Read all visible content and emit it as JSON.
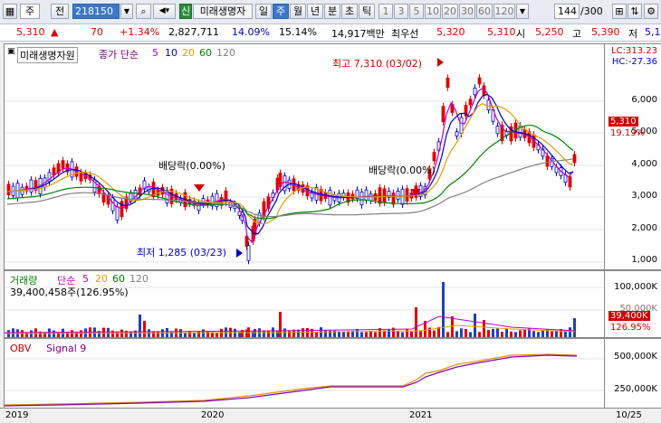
{
  "toolbar": {
    "market_select": "주",
    "view_btn": "전",
    "code": "218150",
    "status_badge": "신",
    "stock_name": "미래생명자",
    "periods": [
      "일",
      "주",
      "월",
      "년",
      "분",
      "초",
      "틱"
    ],
    "active_period": "주",
    "minute_options": [
      "1",
      "3",
      "5",
      "10",
      "20",
      "30",
      "60",
      "120"
    ],
    "count_value": "144",
    "count_total": "/300"
  },
  "quote": {
    "price": "5,310",
    "direction": "▲",
    "change": "70",
    "change_pct": "+1.34%",
    "volume": "2,827,711",
    "turnover_pct": "14.09%",
    "ratio_pct": "15.14%",
    "trade_value": "14,917백만",
    "priority_label": "최우선",
    "ask": "5,320",
    "bid": "5,310",
    "open_label": "시",
    "open": "5,250",
    "high_label": "고",
    "high": "5,390",
    "low_label": "저",
    "low": "5,1"
  },
  "price_panel": {
    "name": "미래생명자원",
    "ma_label": "종가 단순",
    "ma_periods": [
      "5",
      "10",
      "20",
      "60",
      "120"
    ],
    "ma_colors": [
      "#c000c0",
      "#0000c0",
      "#e0a000",
      "#008000",
      "#808080"
    ],
    "lc": "LC:313.23",
    "hc": "HC:-27.36",
    "high_annot": "최고 7,310 (03/02)",
    "low_annot": "최저 1,285 (03/23)",
    "div_annot_1": "배당락(0.00%)",
    "div_annot_2": "배당락(0.00%)",
    "yticks": [
      "6,000",
      "5,000",
      "4,000",
      "3,000",
      "2,000",
      "1,000"
    ],
    "price_tag": "5,310",
    "pct_tag": "19.19%"
  },
  "volume_panel": {
    "name": "거래량",
    "ma_label": "단순",
    "ma_periods": [
      "5",
      "20",
      "60",
      "120"
    ],
    "ma_colors": [
      "#c000c0",
      "#e0a000",
      "#008000",
      "#808080"
    ],
    "value": "39,400,458주(126.95%)",
    "yticks": [
      "100,000K",
      "50,000K"
    ],
    "vol_tag": "39,400K",
    "pct_tag": "126.95%"
  },
  "obv_panel": {
    "name": "OBV",
    "signal": "Signal 9",
    "yticks": [
      "500,000K",
      "250,000K"
    ]
  },
  "xaxis": {
    "labels": [
      "2019",
      "2020",
      "2021"
    ],
    "right_label": "10/25"
  },
  "colors": {
    "up": "#e00000",
    "down": "#0000d0",
    "highlight": "#d00000"
  }
}
